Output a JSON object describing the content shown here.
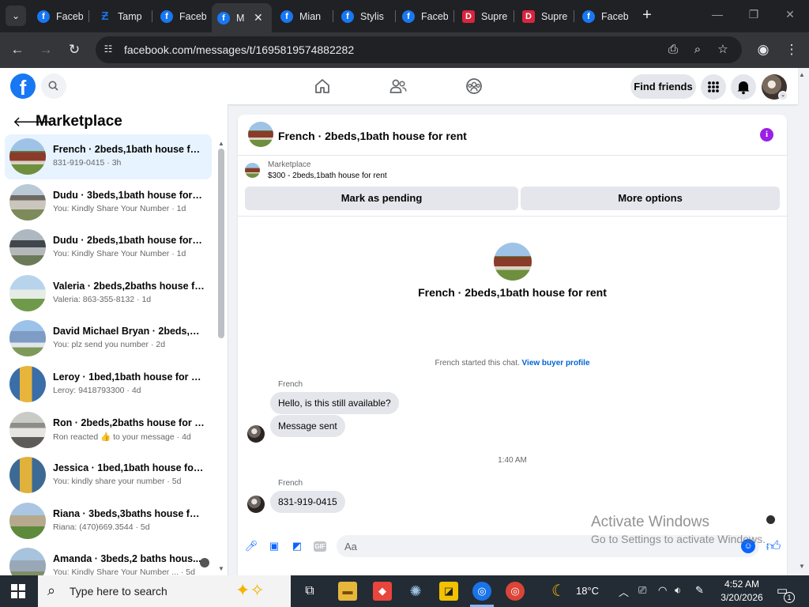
{
  "browser": {
    "tabs": [
      {
        "icon": "facebook-icon",
        "title": "Faceb"
      },
      {
        "icon": "tamp-icon",
        "title": "Tamp"
      },
      {
        "icon": "facebook-icon",
        "title": "Faceb"
      },
      {
        "icon": "facebook-icon",
        "title": "M"
      },
      {
        "icon": "facebook-icon",
        "title": "Mian"
      },
      {
        "icon": "facebook-icon",
        "title": "Stylis"
      },
      {
        "icon": "facebook-icon",
        "title": "Faceb"
      },
      {
        "icon": "supre-icon",
        "title": "Supre"
      },
      {
        "icon": "supre-icon",
        "title": "Supre"
      },
      {
        "icon": "facebook-icon",
        "title": "Faceb"
      }
    ],
    "active_tab_index": 3,
    "url": "facebook.com/messages/t/1695819574882282"
  },
  "fb_nav": {
    "find_friends": "Find friends"
  },
  "sidebar": {
    "title": "Marketplace",
    "conversations": [
      {
        "name": "French · 2beds,1bath house for r...",
        "meta": "831-919-0415 · 3h",
        "selected": true
      },
      {
        "name": "Dudu · 3beds,1bath house for re...",
        "meta": "You: Kindly Share Your Number · 1d"
      },
      {
        "name": "Dudu · 2beds,1bath house for re...",
        "meta": "You: Kindly Share Your Number · 1d"
      },
      {
        "name": "Valeria · 2beds,2baths house for...",
        "meta": "Valeria: 863-355-8132 · 1d"
      },
      {
        "name": "David Michael Bryan · 2beds,2b...",
        "meta": "You: plz send you number · 2d"
      },
      {
        "name": "Leroy · 1bed,1bath house for rent",
        "meta": "Leroy: 9418793300 · 4d"
      },
      {
        "name": "Ron · 2beds,2baths house for rent",
        "meta": "Ron reacted 👍 to your message · 4d"
      },
      {
        "name": "Jessica · 1bed,1bath house for re...",
        "meta": "You: kindly share your number · 5d"
      },
      {
        "name": "Riana · 3beds,3baths house for ...",
        "meta": "Riana: (470)669.3544 · 5d"
      },
      {
        "name": "Amanda · 3beds,2 baths hous...",
        "meta": "You: Kindly Share Your Number ... · 5d"
      }
    ]
  },
  "chat": {
    "title": "French · 2beds,1bath house for rent",
    "marketplace_label": "Marketplace",
    "listing": "$300 - 2beds,1bath house for rent",
    "mark_pending": "Mark as pending",
    "more_options": "More options",
    "conversation_title": "French · 2beds,1bath house for rent",
    "started_text": "French started this chat.",
    "view_buyer": "View buyer profile",
    "messages": [
      {
        "sender": "French",
        "text": "Hello, is this still available?"
      },
      {
        "text": "Message sent"
      }
    ],
    "timestamp": "1:40 AM",
    "messages2": [
      {
        "sender": "French",
        "text": "831-919-0415"
      }
    ],
    "composer_placeholder": "Aa"
  },
  "watermark": {
    "line1": "Activate Windows",
    "line2": "Go to Settings to activate Windows."
  },
  "taskbar": {
    "search_placeholder": "Type here to search",
    "weather": "18°C",
    "time": "4:52 AM",
    "date": "3/20/2026",
    "notifications": "1"
  }
}
